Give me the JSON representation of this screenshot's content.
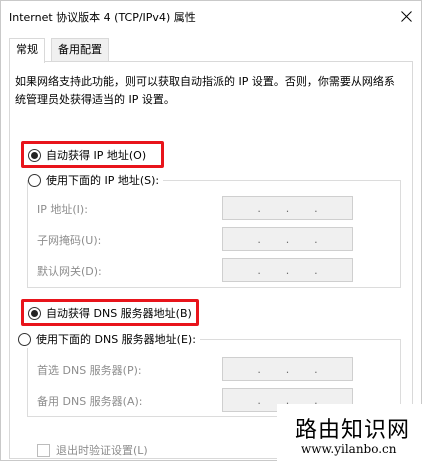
{
  "window": {
    "title": "Internet 协议版本 4 (TCP/IPv4) 属性",
    "close_icon": "close-icon"
  },
  "tabs": [
    {
      "label": "常规",
      "active": true
    },
    {
      "label": "备用配置",
      "active": false
    }
  ],
  "description": "如果网络支持此功能，则可以获取自动指派的 IP 设置。否则，你需要从网络系统管理员处获得适当的 IP 设置。",
  "ip_section": {
    "auto_label": "自动获得 IP 地址(O)",
    "auto_checked": true,
    "manual_label": "使用下面的 IP 地址(S):",
    "manual_checked": false,
    "fields": [
      {
        "label": "IP 地址(I):",
        "value": ". . ."
      },
      {
        "label": "子网掩码(U):",
        "value": ". . ."
      },
      {
        "label": "默认网关(D):",
        "value": ". . ."
      }
    ]
  },
  "dns_section": {
    "auto_label": "自动获得 DNS 服务器地址(B)",
    "auto_checked": true,
    "manual_label": "使用下面的 DNS 服务器地址(E):",
    "manual_checked": false,
    "fields": [
      {
        "label": "首选 DNS 服务器(P):",
        "value": ". . ."
      },
      {
        "label": "备用 DNS 服务器(A):",
        "value": ". . ."
      }
    ]
  },
  "validate_on_exit": {
    "label": "退出时验证设置(L)",
    "checked": false
  },
  "watermark": {
    "title": "路由知识网",
    "url": "www.yilanbo.cn"
  },
  "colors": {
    "highlight": "#e8141b",
    "disabled_text": "#8d8d8d"
  }
}
